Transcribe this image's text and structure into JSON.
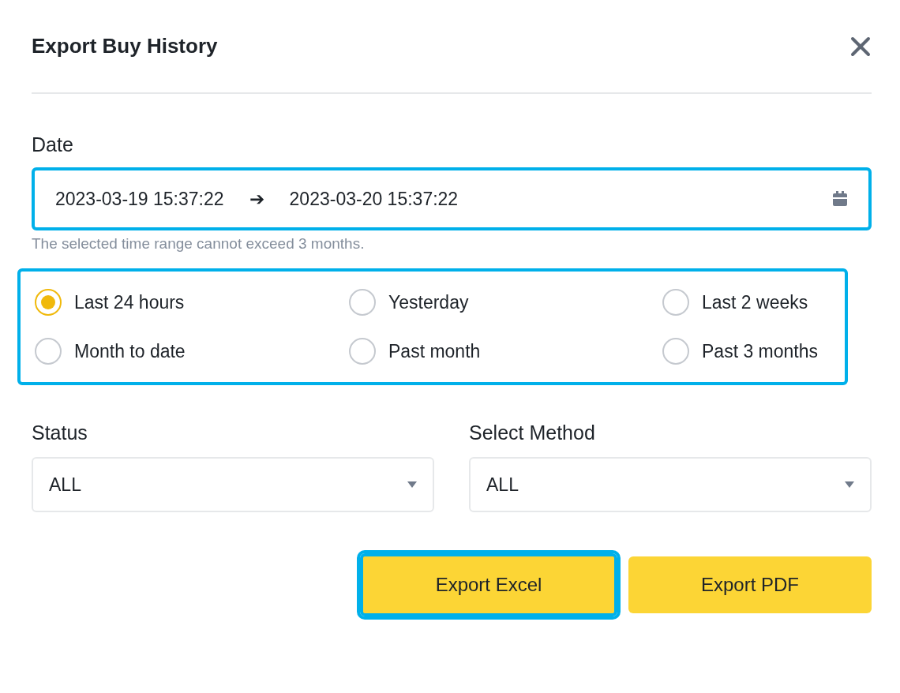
{
  "dialog": {
    "title": "Export Buy History"
  },
  "date": {
    "label": "Date",
    "start": "2023-03-19 15:37:22",
    "arrow": "➔",
    "end": "2023-03-20 15:37:22",
    "hint": "The selected time range cannot exceed 3 months.",
    "highlighted": true
  },
  "ranges": {
    "highlighted": true,
    "options": [
      {
        "label": "Last 24 hours",
        "selected": true
      },
      {
        "label": "Yesterday",
        "selected": false
      },
      {
        "label": "Last 2 weeks",
        "selected": false
      },
      {
        "label": "Month to date",
        "selected": false
      },
      {
        "label": "Past month",
        "selected": false
      },
      {
        "label": "Past 3 months",
        "selected": false
      }
    ]
  },
  "filters": [
    {
      "label": "Status",
      "value": "ALL"
    },
    {
      "label": "Select Method",
      "value": "ALL"
    }
  ],
  "buttons": [
    {
      "label": "Export Excel",
      "highlighted": true
    },
    {
      "label": "Export PDF",
      "highlighted": false
    }
  ]
}
